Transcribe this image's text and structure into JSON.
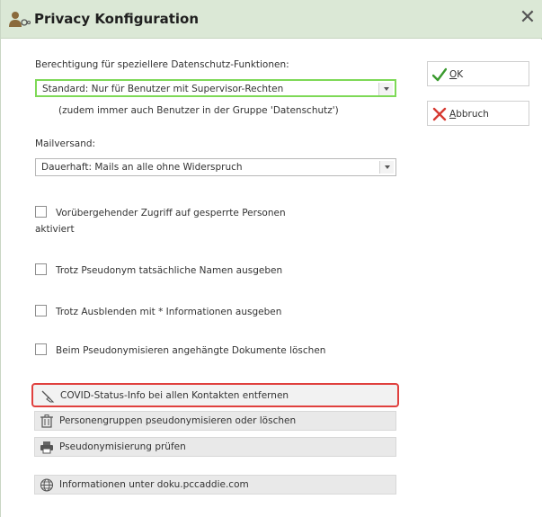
{
  "window": {
    "title": "Privacy Konfiguration",
    "close_label": "✕"
  },
  "form": {
    "permission_label": "Berechtigung für speziellere Datenschutz-Funktionen:",
    "permission_value": "Standard: Nur für Benutzer mit Supervisor-Rechten",
    "permission_note": "(zudem immer auch Benutzer in der Gruppe 'Datenschutz')",
    "mail_label": "Mailversand:",
    "mail_value": "Dauerhaft: Mails an alle ohne Widerspruch"
  },
  "checkboxes": [
    {
      "line1": "Vorübergehender Zugriff auf gesperrte Personen",
      "line2": "aktiviert",
      "checked": false
    },
    {
      "line1": "Trotz Pseudonym tatsächliche Namen ausgeben",
      "checked": false
    },
    {
      "line1": "Trotz Ausblenden mit * Informationen ausgeben",
      "checked": false
    },
    {
      "line1": "Beim Pseudonymisieren angehängte Dokumente löschen",
      "checked": false
    }
  ],
  "actions": [
    {
      "label": "COVID-Status-Info bei allen Kontakten entfernen",
      "icon": "broom-icon"
    },
    {
      "label": "Personengruppen pseudonymisieren oder löschen",
      "icon": "trash-icon"
    },
    {
      "label": "Pseudonymisierung prüfen",
      "icon": "printer-icon"
    },
    {
      "label": "Informationen unter doku.pccaddie.com",
      "icon": "globe-icon"
    }
  ],
  "side_buttons": {
    "ok_accel": "O",
    "ok_rest": "K",
    "cancel_accel": "A",
    "cancel_rest": "bbruch"
  },
  "colors": {
    "title_bg": "#dbe8d6",
    "focus_green": "#7ed957",
    "highlight_red": "#e0403e",
    "ok_green": "#3a9a2e",
    "cancel_red": "#d63a32"
  }
}
